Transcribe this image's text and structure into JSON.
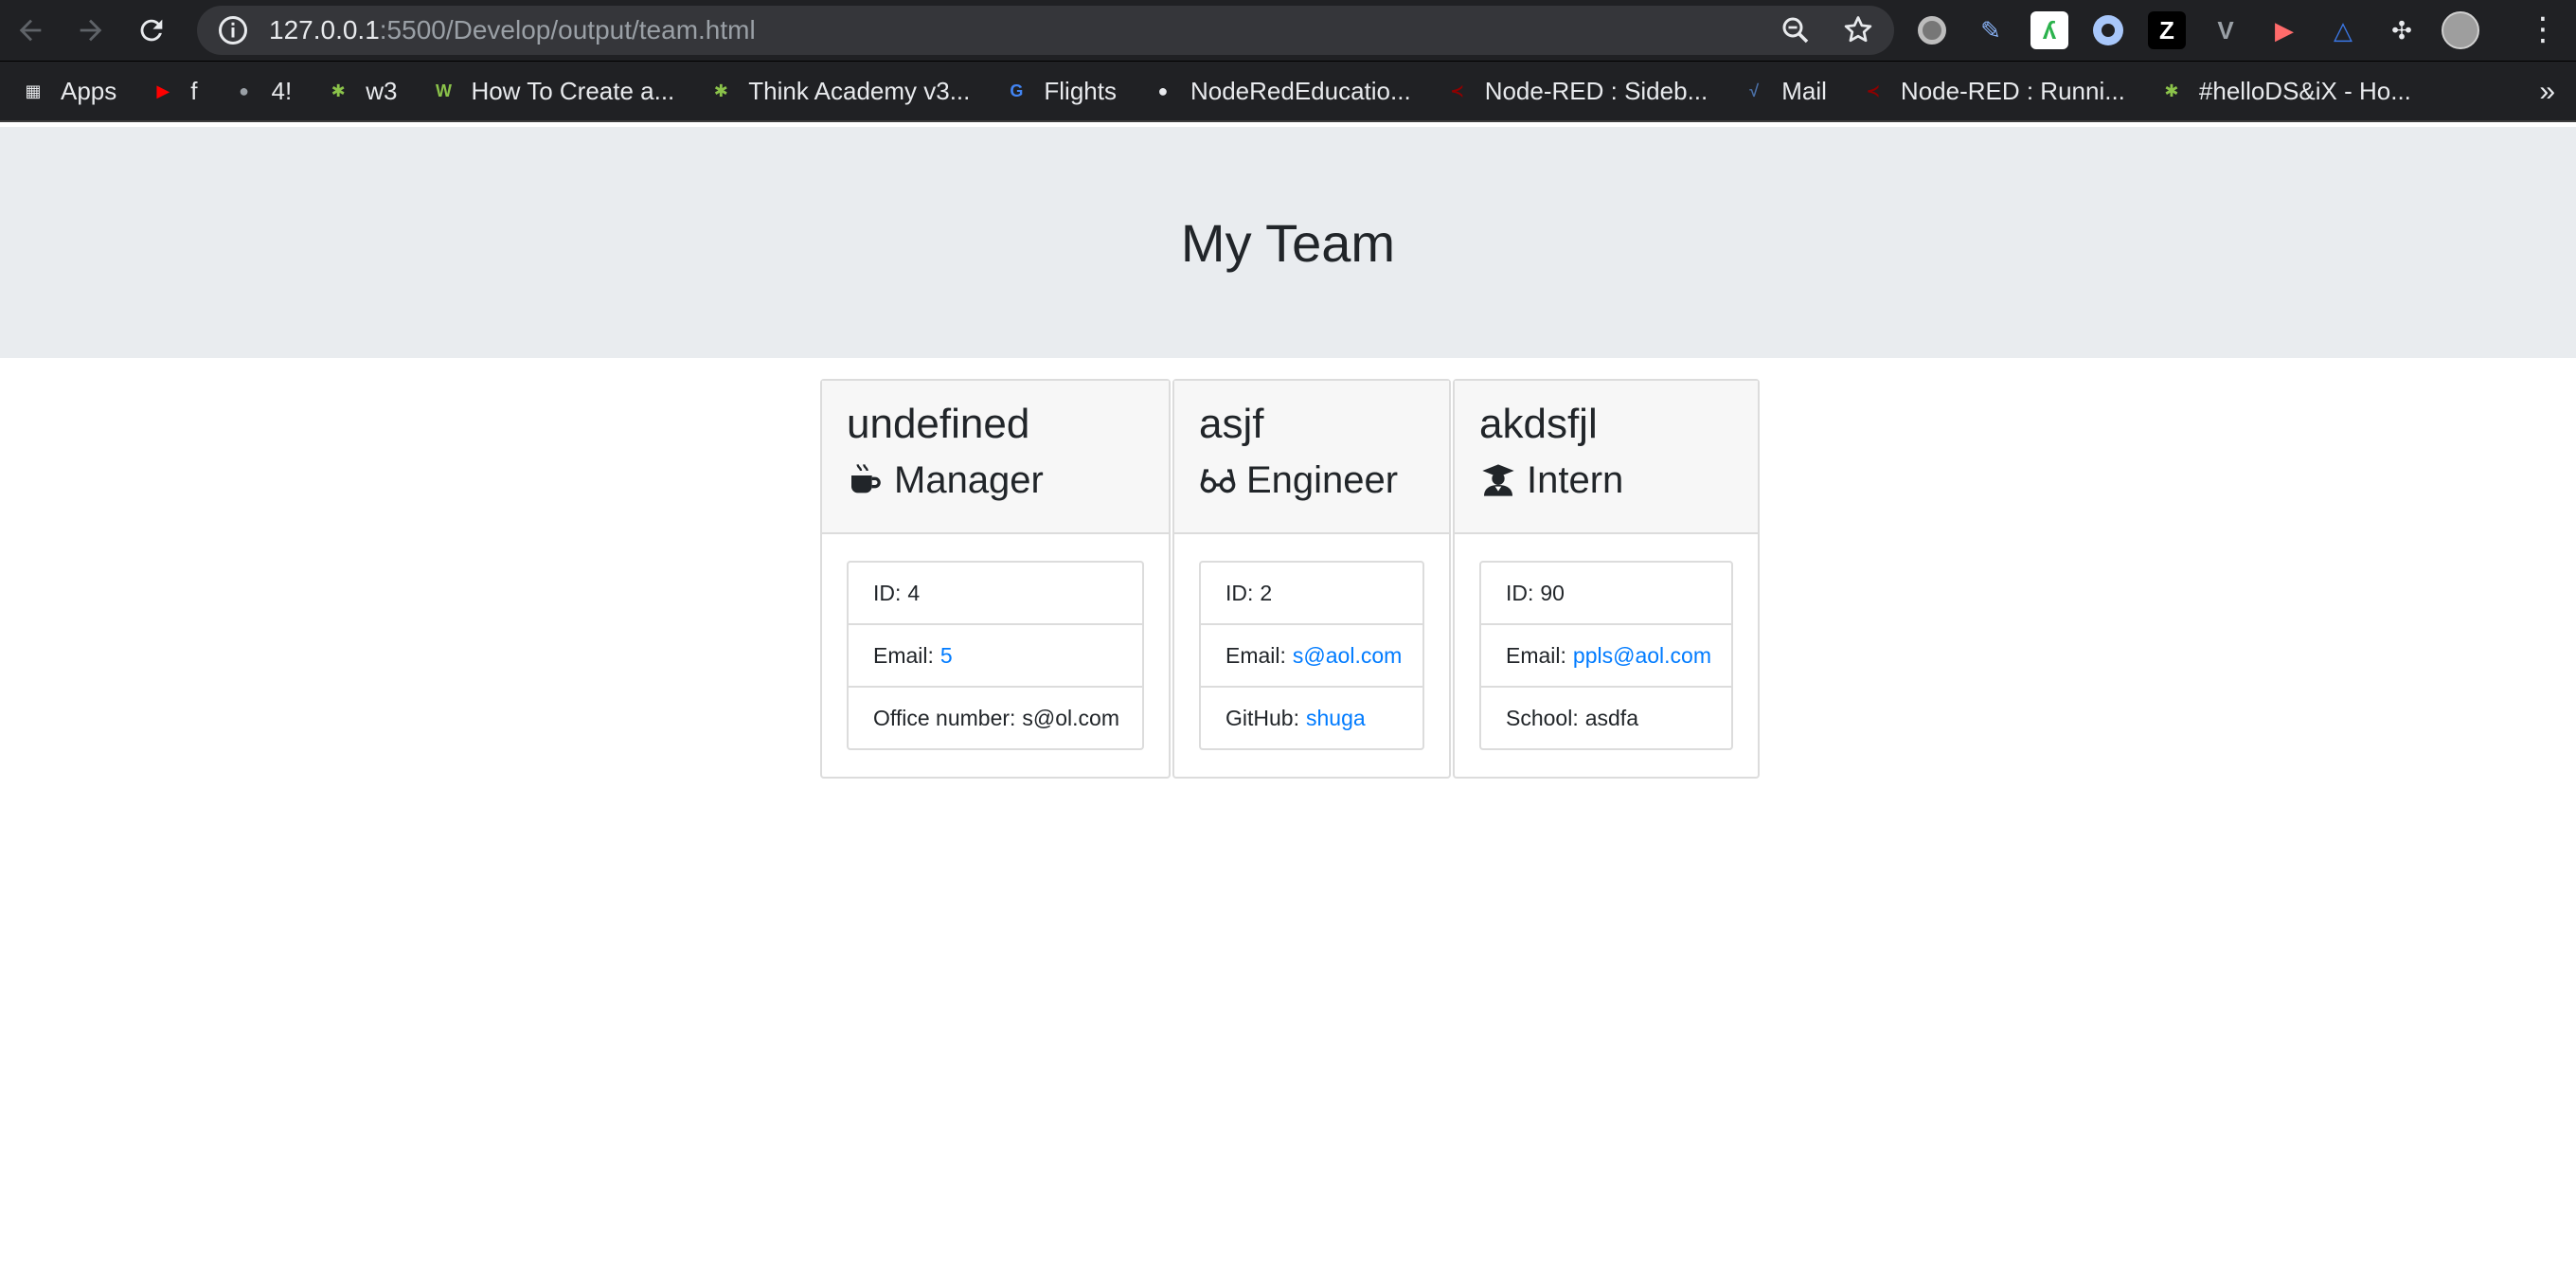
{
  "browser": {
    "url_host": "127.0.0.1",
    "url_rest": ":5500/Develop/output/team.html",
    "bookmarks": [
      {
        "label": "Apps",
        "icon": "apps-grid-icon",
        "color": "#e8eaed"
      },
      {
        "label": "f",
        "icon": "youtube-icon",
        "color": "#ff0000"
      },
      {
        "label": "4!",
        "icon": "apple-icon",
        "color": "#9aa0a6"
      },
      {
        "label": "w3",
        "icon": "bee-icon",
        "color": "#8bc34a"
      },
      {
        "label": "How To Create a...",
        "icon": "w3-icon",
        "color": "#8bc34a"
      },
      {
        "label": "Think Academy v3...",
        "icon": "bee-icon",
        "color": "#8bc34a"
      },
      {
        "label": "Flights",
        "icon": "google-flights-icon",
        "color": "#4285f4"
      },
      {
        "label": "NodeRedEducatio...",
        "icon": "github-icon",
        "color": "#e8eaed"
      },
      {
        "label": "Node-RED : Sideb...",
        "icon": "node-red-icon",
        "color": "#8f0000"
      },
      {
        "label": "Mail",
        "icon": "mail-icon",
        "color": "#4a6fa5"
      },
      {
        "label": "Node-RED : Runni...",
        "icon": "node-red-icon",
        "color": "#8f0000"
      },
      {
        "label": "#helloDS&iX - Ho...",
        "icon": "bee-icon",
        "color": "#8bc34a"
      }
    ]
  },
  "page": {
    "title": "My Team"
  },
  "team": [
    {
      "name": "undefined",
      "role": "Manager",
      "role_icon": "coffee-mug-icon",
      "id_label": "ID:",
      "id": "4",
      "email_label": "Email:",
      "email": "5",
      "extra_label": "Office number:",
      "extra": "s@ol.com",
      "extra_link": false
    },
    {
      "name": "asjf",
      "role": "Engineer",
      "role_icon": "glasses-icon",
      "id_label": "ID:",
      "id": "2",
      "email_label": "Email:",
      "email": "s@aol.com",
      "extra_label": "GitHub:",
      "extra": "shuga",
      "extra_link": true
    },
    {
      "name": "akdsfjl",
      "role": "Intern",
      "role_icon": "graduate-icon",
      "id_label": "ID:",
      "id": "90",
      "email_label": "Email:",
      "email": "ppls@aol.com",
      "extra_label": "School:",
      "extra": "asdfa",
      "extra_link": false
    }
  ],
  "colors": {
    "link": "#007bff",
    "jumbotron": "#e9ecef",
    "chrome": "#202124"
  }
}
